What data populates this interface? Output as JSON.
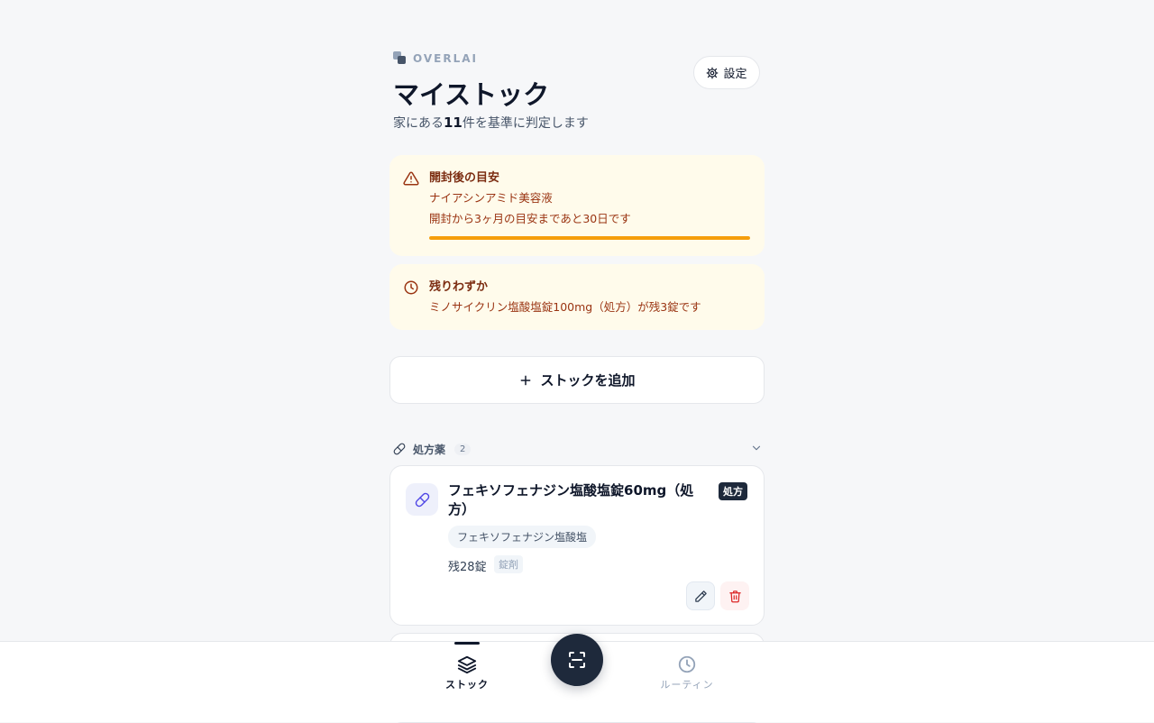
{
  "header": {
    "brand": "OVERLAI",
    "title": "マイストック",
    "subtitle_prefix": "家にある",
    "subtitle_count": "11",
    "subtitle_suffix": "件を基準に判定します",
    "settings_label": "設定"
  },
  "alerts": [
    {
      "title": "開封後の目安",
      "item": "ナイアシンアミド美容液",
      "detail": "開封から3ヶ月の目安まであと30日です",
      "icon": "warning-triangle-icon",
      "progress": 1.0
    },
    {
      "title": "残りわずか",
      "detail": "ミノサイクリン塩酸塩錠100mg（処方）が残3錠です",
      "icon": "clock-icon"
    }
  ],
  "add_button_label": "ストックを追加",
  "section": {
    "label": "処方薬",
    "count": "2",
    "icon": "pill-icon"
  },
  "cards": [
    {
      "title": "フェキソフェナジン塩酸塩錠60mg（処方）",
      "badge": "処方",
      "ingredient": "フェキソフェナジン塩酸塩",
      "quantity": "残28錠",
      "form": "錠剤"
    }
  ],
  "nav": {
    "stock_label": "ストック",
    "routine_label": "ルーティン"
  },
  "colors": {
    "accent": "#1e293b",
    "alert_bg": "#fffbeb",
    "progress": "#f59e0b",
    "delete": "#dc2626"
  }
}
